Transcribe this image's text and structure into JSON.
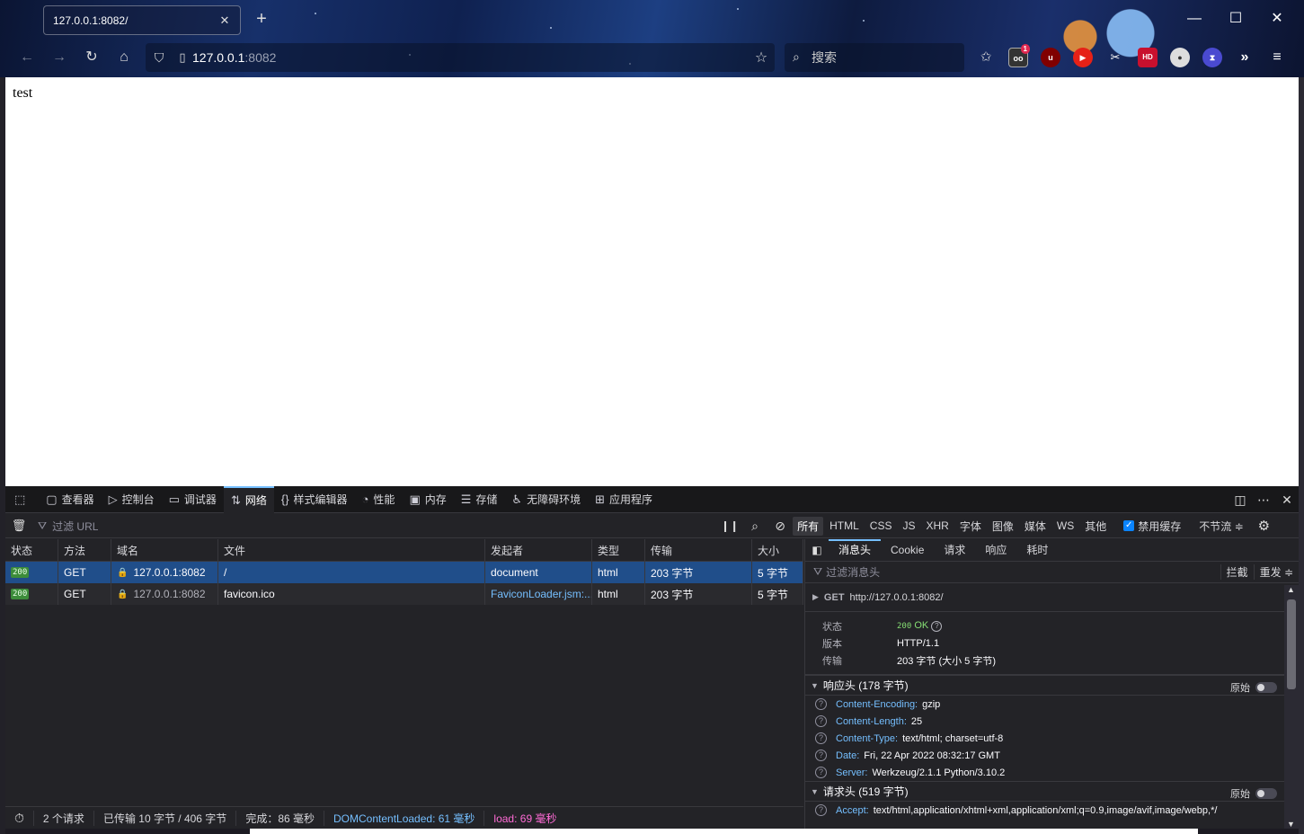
{
  "browser": {
    "tab_title": "127.0.0.1:8082/",
    "url_host": "127.0.0.1",
    "url_port": ":8082",
    "search_placeholder": "搜索",
    "ext_badge_count": "1"
  },
  "page": {
    "body_text": "test"
  },
  "devtools": {
    "tabs": [
      {
        "label": "查看器",
        "icon": "inspector-icon"
      },
      {
        "label": "控制台",
        "icon": "console-icon"
      },
      {
        "label": "调试器",
        "icon": "debugger-icon"
      },
      {
        "label": "网络",
        "icon": "network-icon"
      },
      {
        "label": "样式编辑器",
        "icon": "braces-icon"
      },
      {
        "label": "性能",
        "icon": "gauge-icon"
      },
      {
        "label": "内存",
        "icon": "memory-chip-icon"
      },
      {
        "label": "存储",
        "icon": "storage-icon"
      },
      {
        "label": "无障碍环境",
        "icon": "accessibility-icon"
      },
      {
        "label": "应用程序",
        "icon": "grid-icon"
      }
    ],
    "filter_placeholder": "过滤 URL",
    "filter_types": [
      "所有",
      "HTML",
      "CSS",
      "JS",
      "XHR",
      "字体",
      "图像",
      "媒体",
      "WS",
      "其他"
    ],
    "disable_cache_label": "禁用缓存",
    "throttle_label": "不节流 ≑",
    "columns": [
      "状态",
      "方法",
      "域名",
      "文件",
      "发起者",
      "类型",
      "传输",
      "大小"
    ],
    "requests": [
      {
        "status": "200",
        "method": "GET",
        "domain": "127.0.0.1:8082",
        "file": "/",
        "initiator": "document",
        "type": "html",
        "transferred": "203 字节",
        "size": "5 字节"
      },
      {
        "status": "200",
        "method": "GET",
        "domain": "127.0.0.1:8082",
        "file": "favicon.ico",
        "initiator": "FaviconLoader.jsm:...",
        "type": "html",
        "transferred": "203 字节",
        "size": "5 字节"
      }
    ],
    "statusbar": {
      "requests": "2 个请求",
      "transferred": "已传输 10 字节 / 406 字节",
      "finish": "完成：86 毫秒",
      "dcl": "DOMContentLoaded: 61 毫秒",
      "load": "load: 69 毫秒"
    },
    "side": {
      "tabs": [
        "消息头",
        "Cookie",
        "请求",
        "响应",
        "耗时"
      ],
      "filter_placeholder": "过滤消息头",
      "block_label": "拦截",
      "resend_label": "重发 ≑",
      "request_line_method": "GET",
      "request_line_url": "http://127.0.0.1:8082/",
      "summary": [
        {
          "k": "状态",
          "v": "OK",
          "code": "200"
        },
        {
          "k": "版本",
          "v": "HTTP/1.1"
        },
        {
          "k": "传输",
          "v": "203 字节 (大小 5 字节)"
        }
      ],
      "response_section": "响应头 (178 字节)",
      "raw_label": "原始",
      "response_headers": [
        {
          "k": "Content-Encoding:",
          "v": "gzip"
        },
        {
          "k": "Content-Length:",
          "v": "25"
        },
        {
          "k": "Content-Type:",
          "v": "text/html; charset=utf-8"
        },
        {
          "k": "Date:",
          "v": "Fri, 22 Apr 2022 08:32:17 GMT"
        },
        {
          "k": "Server:",
          "v": "Werkzeug/2.1.1 Python/3.10.2"
        }
      ],
      "request_section": "请求头 (519 字节)",
      "request_headers": [
        {
          "k": "Accept:",
          "v": "text/html,application/xhtml+xml,application/xml;q=0.9,image/avif,image/webp,*/"
        }
      ]
    }
  },
  "colors": {
    "accent": "#75bfff",
    "selected_row": "#204e8a",
    "status_ok": "#3c8c3a",
    "dcl": "#75bfff",
    "load": "#ff6bd6"
  }
}
